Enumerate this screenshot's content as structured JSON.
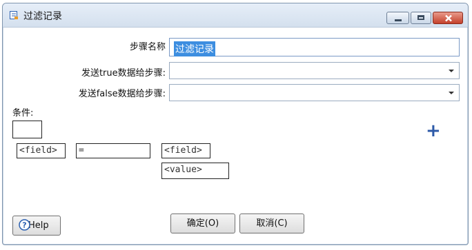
{
  "window": {
    "title": "过滤记录"
  },
  "form": {
    "step_name_label": "步骤名称",
    "step_name_value": "过滤记录",
    "send_true_label": "发送true数据给步骤:",
    "send_true_value": "",
    "send_false_label": "发送false数据给步骤:",
    "send_false_value": ""
  },
  "condition": {
    "label": "条件:",
    "field_left": "<field>",
    "operator": "=",
    "field_right": "<field>",
    "value": "<value>"
  },
  "buttons": {
    "help": "Help",
    "ok": "确定(O)",
    "cancel": "取消(C)"
  },
  "icons": {
    "window_icon": "document-icon",
    "add": "plus-icon",
    "help": "help-icon"
  },
  "colors": {
    "selection": "#3d8ee0",
    "accent": "#2d5aa8",
    "close_button": "#c4412b"
  }
}
